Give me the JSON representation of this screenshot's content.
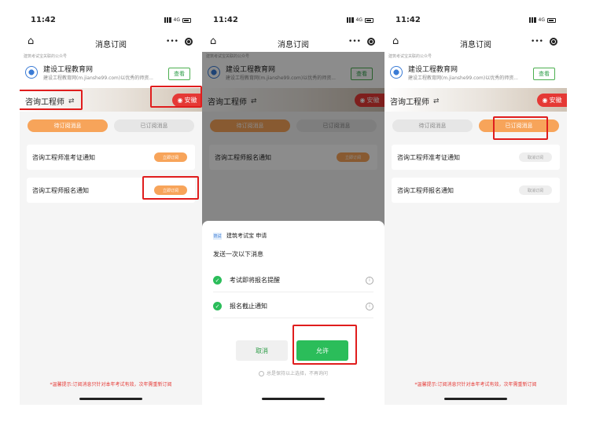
{
  "status": {
    "time": "11:42",
    "network": "4G"
  },
  "nav": {
    "title": "消息订阅",
    "more": "•••"
  },
  "account": {
    "subtitle": "建筑考试宝关联的公众号",
    "name": "建设工程教育网",
    "desc": "建设工程教育网(m.jianshe99.com)以优秀的师资...",
    "view_label": "查看"
  },
  "banner": {
    "exam": "咨询工程师",
    "location": "安徽"
  },
  "tabs": {
    "pending": "待订阅消息",
    "subscribed": "已订阅消息"
  },
  "screen1": {
    "items": [
      {
        "title": "咨询工程师准考证通知",
        "action": "立即订阅"
      },
      {
        "title": "咨询工程师报名通知",
        "action": "立即订阅"
      }
    ]
  },
  "screen2": {
    "items": [
      {
        "title": "咨询工程师报名通知",
        "action": "立即订阅"
      }
    ],
    "dialog": {
      "app_logo": "筑试",
      "app_label": "建筑考试宝 申请",
      "title": "发送一次以下消息",
      "permissions": [
        "考试即将报名提醒",
        "报名截止通知"
      ],
      "deny": "取消",
      "allow": "允许",
      "always_keep": "总是保持以上选择，不再询问"
    }
  },
  "screen3": {
    "items": [
      {
        "title": "咨询工程师准考证通知",
        "action": "取消订阅"
      },
      {
        "title": "咨询工程师报名通知",
        "action": "取消订阅"
      }
    ]
  },
  "footer": {
    "tip": "*温馨提示:订阅消息只针对本年考试有效，次年需重新订阅"
  },
  "colors": {
    "accent_orange": "#f7a45a",
    "green": "#2bbd5a",
    "red": "#e53935",
    "highlight": "#e01d1d"
  }
}
